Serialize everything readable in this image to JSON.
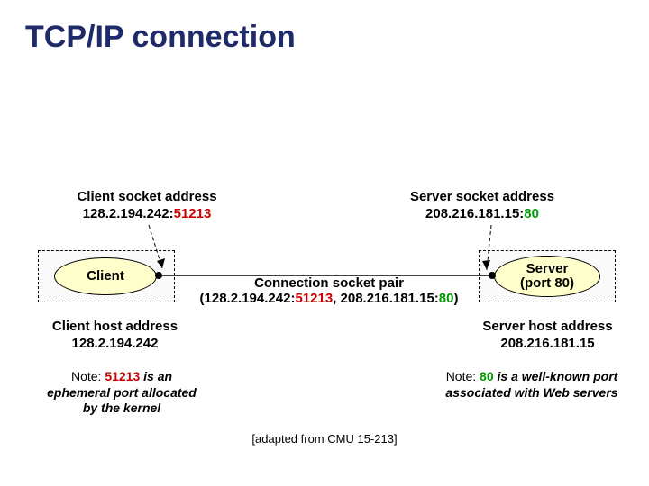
{
  "title": "TCP/IP connection",
  "client_socket": {
    "heading": "Client socket address",
    "ip": "128.2.194.242",
    "port": "51213"
  },
  "server_socket": {
    "heading": "Server socket address",
    "ip": "208.216.181.15",
    "port": "80"
  },
  "client_node": "Client",
  "server_node_line1": "Server",
  "server_node_line2": "(port 80)",
  "conn_pair": {
    "heading": "Connection socket pair",
    "open": "(",
    "client_ip": "128.2.194.242",
    "client_port": "51213",
    "sep": ", ",
    "server_ip": "208.216.181.15",
    "server_port": "80",
    "close": ")"
  },
  "client_host": {
    "heading": "Client host address",
    "ip": "128.2.194.242"
  },
  "server_host": {
    "heading": "Server host address",
    "ip": "208.216.181.15"
  },
  "client_note_a": "Note: ",
  "client_note_port": "51213",
  "client_note_b": " is an",
  "client_note_c": "ephemeral port allocated",
  "client_note_d": "by the kernel",
  "server_note_a": "Note: ",
  "server_note_port": "80",
  "server_note_b": " is a well-known port",
  "server_note_c": "associated with Web servers",
  "attribution": "[adapted from CMU 15-213]"
}
